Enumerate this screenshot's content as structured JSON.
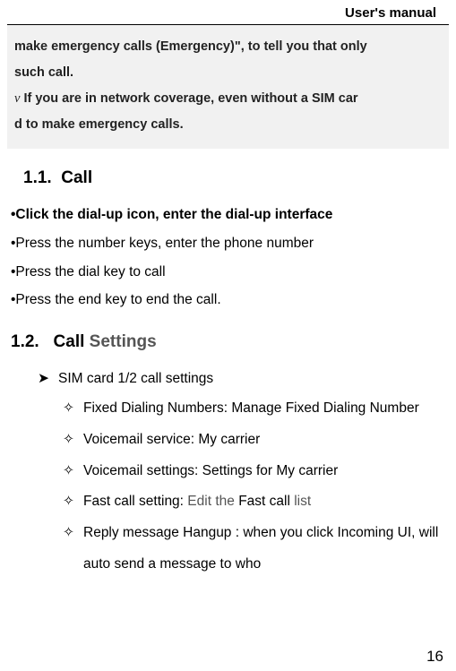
{
  "header": {
    "title": "User's manual"
  },
  "grayBox": {
    "line1": "make emergency calls (Emergency)\", to tell you that only",
    "line2": " such call.",
    "bullet": "ν",
    "line3a": " If you are in network coverage, even without a SIM car",
    "line4": "d to make emergency calls."
  },
  "sec11": {
    "num": "1.1.",
    "title": "Call",
    "b1": "•Click the dial-up icon, enter the dial-up interface",
    "b2": "•Press the number keys, enter the phone number",
    "b3": "•Press the dial key to call",
    "b4": "•Press the end key to end the call."
  },
  "sec12": {
    "num": "1.2.",
    "title_a": "Call",
    "title_b": " Settings",
    "l1_marker": "➤",
    "l1_text": "SIM card 1/2 call settings",
    "l2_marker": "✧",
    "i1": "Fixed Dialing Numbers: Manage Fixed Dialing Number",
    "i2": "Voicemail service: My carrier",
    "i3": "Voicemail settings: Settings for My carrier",
    "i4_a": "Fast call setting:",
    "i4_b": " Edit the ",
    "i4_c": "Fast call",
    "i4_d": " list",
    "i5": "Reply message Hangup : when you click Incoming UI, will auto send a message to who"
  },
  "pageNumber": "16"
}
